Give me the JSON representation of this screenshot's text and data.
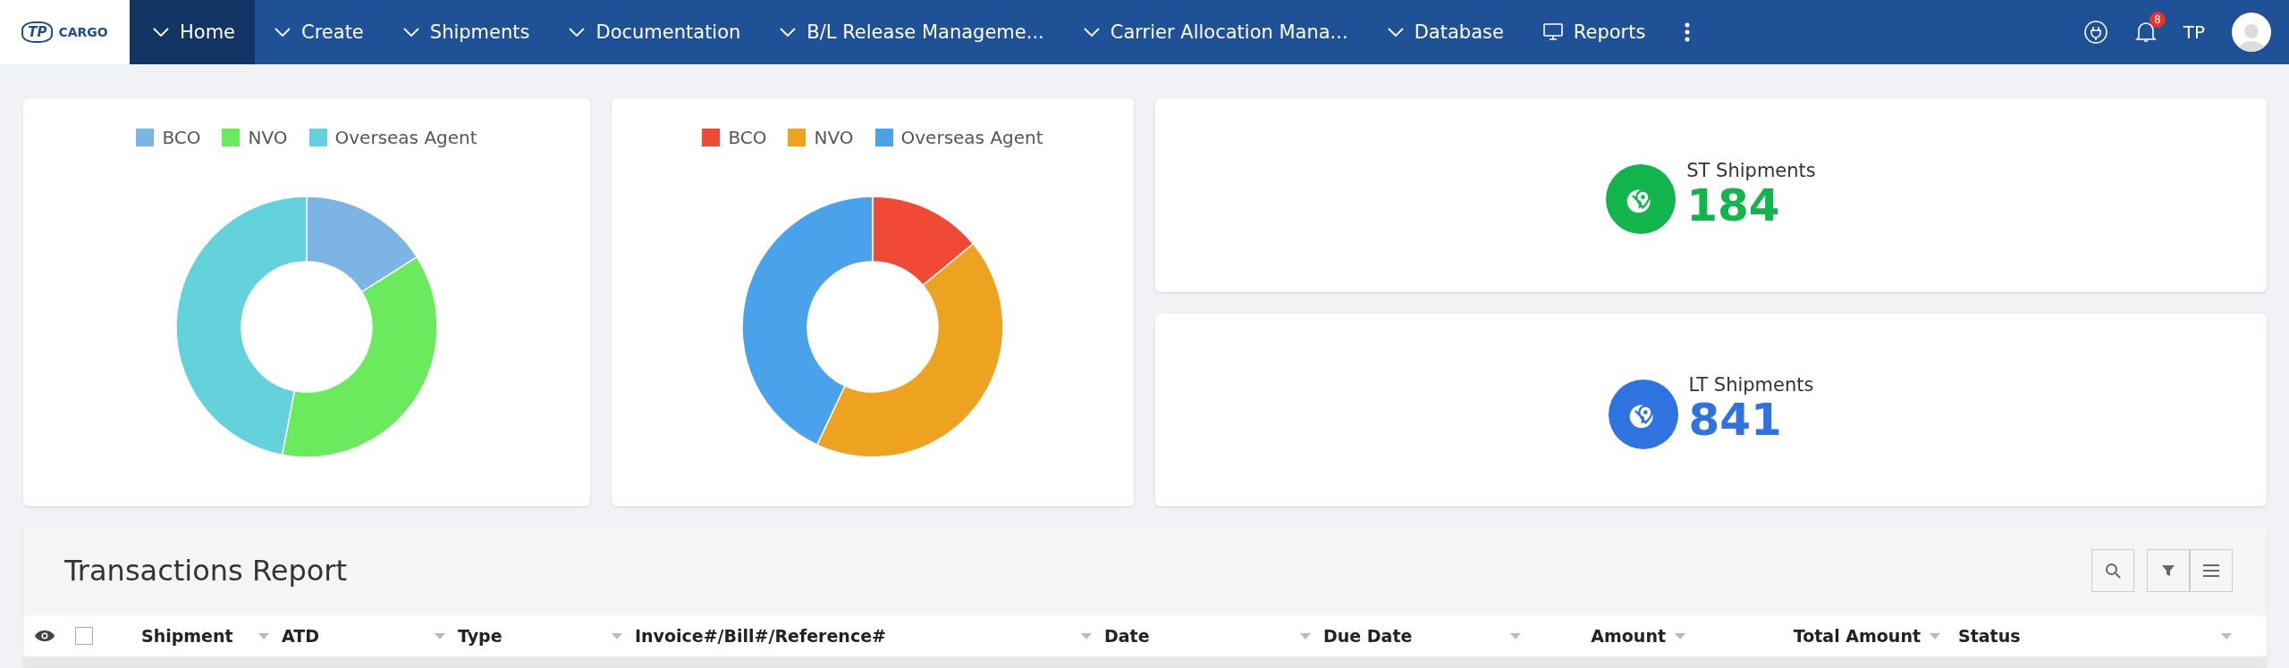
{
  "navbar": {
    "logo": {
      "mark": "TP",
      "name": "CARGO"
    },
    "menu": [
      {
        "label": "Home",
        "kind": "dropdown",
        "selected": true
      },
      {
        "label": "Create",
        "kind": "dropdown",
        "selected": false
      },
      {
        "label": "Shipments",
        "kind": "dropdown",
        "selected": false
      },
      {
        "label": "Documentation",
        "kind": "dropdown",
        "selected": false
      },
      {
        "label": "B/L Release Manageme...",
        "kind": "dropdown",
        "selected": false
      },
      {
        "label": "Carrier Allocation Mana...",
        "kind": "dropdown",
        "selected": false
      },
      {
        "label": "Database",
        "kind": "dropdown",
        "selected": false
      },
      {
        "label": "Reports",
        "kind": "screen",
        "selected": false
      }
    ],
    "notifications": {
      "count": "8"
    },
    "user": {
      "initials": "TP"
    }
  },
  "charts": [
    {
      "legend": [
        {
          "label": "BCO",
          "color": "#7cb5e4"
        },
        {
          "label": "NVO",
          "color": "#6aea5c"
        },
        {
          "label": "Overseas Agent",
          "color": "#64d2da"
        }
      ]
    },
    {
      "legend": [
        {
          "label": "BCO",
          "color": "#f04a37"
        },
        {
          "label": "NVO",
          "color": "#eea320"
        },
        {
          "label": "Overseas Agent",
          "color": "#4aa3ea"
        }
      ]
    }
  ],
  "stats": [
    {
      "label": "ST Shipments",
      "value": "184",
      "color": "#12b54c"
    },
    {
      "label": "LT Shipments",
      "value": "841",
      "color": "#2f73e0"
    }
  ],
  "report": {
    "title": "Transactions Report",
    "select_all_checked": false,
    "columns": [
      {
        "label": "Shipment"
      },
      {
        "label": "ATD"
      },
      {
        "label": "Type"
      },
      {
        "label": "Invoice#/Bill#/Reference#"
      },
      {
        "label": "Date"
      },
      {
        "label": "Due Date"
      },
      {
        "label": "Amount"
      },
      {
        "label": "Total Amount"
      },
      {
        "label": "Status"
      }
    ]
  }
}
